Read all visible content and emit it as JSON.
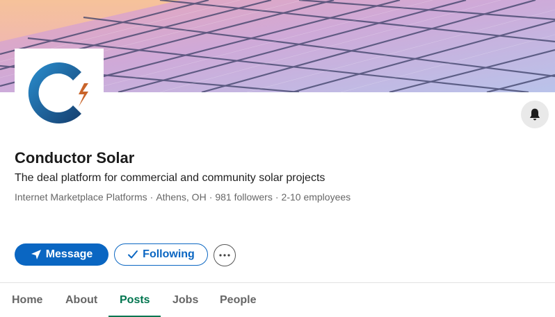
{
  "company": {
    "name": "Conductor Solar",
    "tagline": "The deal platform for commercial and community solar projects",
    "industry": "Internet Marketplace Platforms",
    "location": "Athens, OH",
    "followers": "981 followers",
    "employees": "2-10 employees",
    "separator": "·"
  },
  "actions": {
    "message_label": "Message",
    "following_label": "Following",
    "more_icon": "ellipsis-icon",
    "bell_icon": "bell-icon"
  },
  "tabs": [
    {
      "label": "Home",
      "active": false
    },
    {
      "label": "About",
      "active": false
    },
    {
      "label": "Posts",
      "active": true
    },
    {
      "label": "Jobs",
      "active": false
    },
    {
      "label": "People",
      "active": false
    }
  ],
  "colors": {
    "primary": "#0a66c2",
    "active_tab": "#01754f",
    "logo_blue": "#1b5e8f",
    "logo_orange": "#c9642a"
  }
}
